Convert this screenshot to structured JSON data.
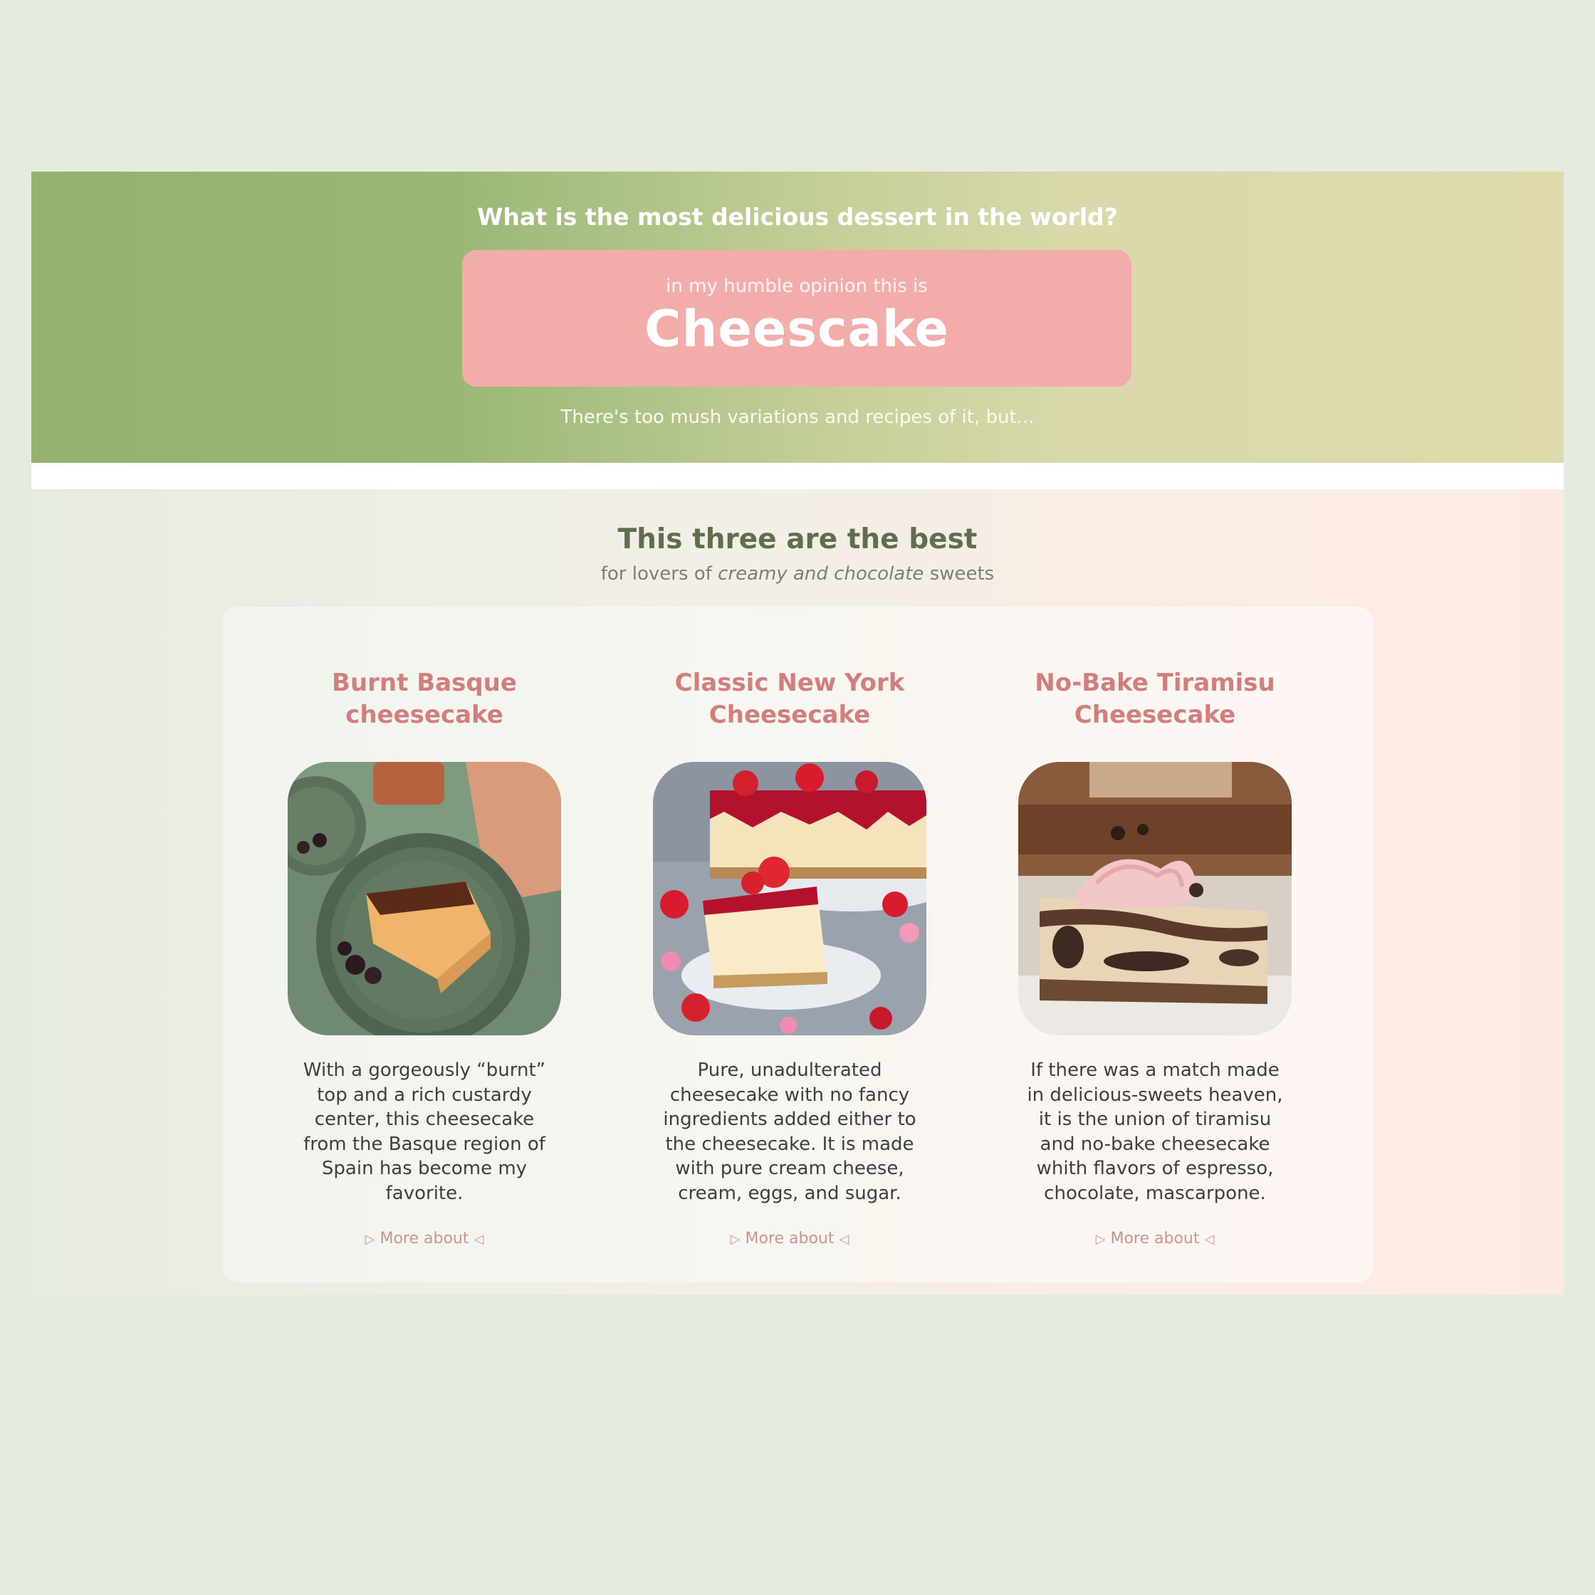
{
  "hero": {
    "question": "What is the most delicious dessert in the world?",
    "kicker": "in my humble opinion this is",
    "title": "Cheescake",
    "note": "There's too mush variations and recipes of it, but..."
  },
  "section": {
    "title": "This three are the best",
    "subtitle_pre": "for lovers of ",
    "subtitle_em": "creamy and chocolate",
    "subtitle_post": " sweets"
  },
  "cards": [
    {
      "title_line1": "Burnt Basque",
      "title_line2": "cheesecake",
      "text_lines": [
        "With a gorgeously “burnt”",
        "top and a rich custardy",
        "center, this cheesecake",
        "from the Basque region of",
        "Spain has become my",
        "favorite."
      ],
      "link": "More about",
      "image_icon": "burnt-basque-cheesecake-photo"
    },
    {
      "title_line1": "Classic New York",
      "title_line2": "Cheesecake",
      "text_lines": [
        "Pure, unadulterated",
        "cheesecake with no fancy",
        "ingredients added either to",
        "the cheesecake. It is made",
        "with pure cream cheese,",
        "cream, eggs, and sugar."
      ],
      "link": "More about",
      "image_icon": "new-york-cheesecake-photo"
    },
    {
      "title_line1": "No-Bake Tiramisu",
      "title_line2": "Cheesecake",
      "text_lines": [
        "If there was a match made",
        "in delicious-sweets heaven,",
        "it is the union of tiramisu",
        "and no-bake cheesecake",
        "whith flavors of espresso,",
        "chocolate, mascarpone."
      ],
      "link": "More about",
      "image_icon": "tiramisu-cheesecake-photo"
    }
  ],
  "colors": {
    "background": "#e6ebe0",
    "hero_green": "#93b26f",
    "hero_pink": "#f2adab",
    "card_title": "#d27e7c",
    "section_title": "#5f6e4d"
  }
}
